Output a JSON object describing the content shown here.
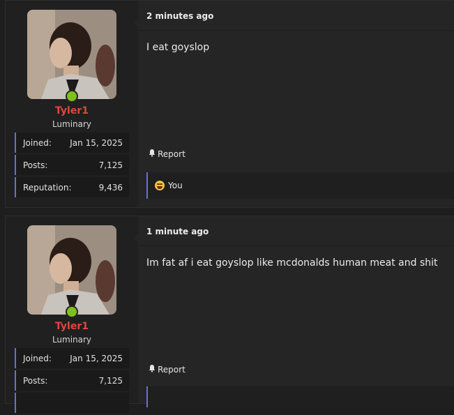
{
  "posts": [
    {
      "time": "2 minutes ago",
      "message": "I eat goyslop",
      "report_label": "Report",
      "reaction_label": "You",
      "author": {
        "name": "Tyler1",
        "title": "Luminary",
        "stats": [
          {
            "label": "Joined:",
            "value": "Jan 15, 2025"
          },
          {
            "label": "Posts:",
            "value": "7,125"
          },
          {
            "label": "Reputation:",
            "value": "9,436"
          }
        ]
      }
    },
    {
      "time": "1 minute ago",
      "message": "Im fat af i eat goyslop like mcdonalds human meat and shit",
      "report_label": "Report",
      "author": {
        "name": "Tyler1",
        "title": "Luminary",
        "stats": [
          {
            "label": "Joined:",
            "value": "Jan 15, 2025"
          },
          {
            "label": "Posts:",
            "value": "7,125"
          }
        ]
      }
    }
  ],
  "colors": {
    "username": "#e0473a",
    "online": "#7ec11e",
    "accent": "#6a6ed6"
  },
  "icons": {
    "report": "bell-icon",
    "reaction": "tears-of-joy-emoji-icon",
    "presence": "online-status-dot"
  }
}
